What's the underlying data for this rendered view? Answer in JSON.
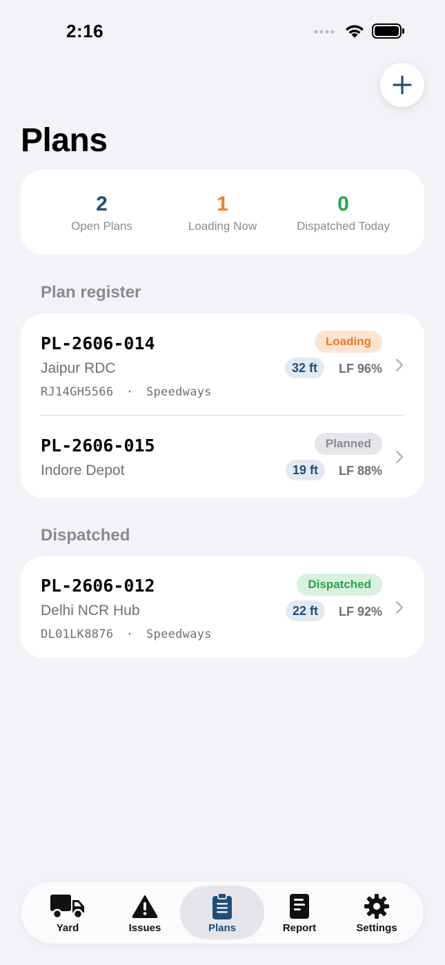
{
  "status_bar": {
    "time": "2:16"
  },
  "header": {
    "title": "Plans",
    "add_button_icon": "plus-icon"
  },
  "stats": [
    {
      "value": "2",
      "label": "Open Plans",
      "color": "#1f4e79"
    },
    {
      "value": "1",
      "label": "Loading Now",
      "color": "#f07b24"
    },
    {
      "value": "0",
      "label": "Dispatched Today",
      "color": "#26a548"
    }
  ],
  "sections": {
    "register": {
      "title": "Plan register",
      "plans": [
        {
          "id": "PL-2606-014",
          "destination": "Jaipur RDC",
          "status": "Loading",
          "size": "32 ft",
          "lf": "LF 96%",
          "vehicle": "RJ14GH5566",
          "separator": "·",
          "carrier": "Speedways"
        },
        {
          "id": "PL-2606-015",
          "destination": "Indore Depot",
          "status": "Planned",
          "size": "19 ft",
          "lf": "LF 88%"
        }
      ]
    },
    "dispatched": {
      "title": "Dispatched",
      "plans": [
        {
          "id": "PL-2606-012",
          "destination": "Delhi NCR Hub",
          "status": "Dispatched",
          "size": "22 ft",
          "lf": "LF 92%",
          "vehicle": "DL01LK8876",
          "separator": "·",
          "carrier": "Speedways"
        }
      ]
    }
  },
  "status_colors": {
    "Loading": {
      "bg": "#fde4d2",
      "fg": "#ee7a22"
    },
    "Planned": {
      "bg": "#e6e6ea",
      "fg": "#8a8a8e"
    },
    "Dispatched": {
      "bg": "#d9f1df",
      "fg": "#27a54a"
    }
  },
  "tabbar": {
    "active": "Plans",
    "tabs": [
      {
        "label": "Yard",
        "icon": "truck-icon"
      },
      {
        "label": "Issues",
        "icon": "warning-icon"
      },
      {
        "label": "Plans",
        "icon": "clipboard-icon"
      },
      {
        "label": "Report",
        "icon": "report-icon"
      },
      {
        "label": "Settings",
        "icon": "gear-icon"
      }
    ]
  }
}
